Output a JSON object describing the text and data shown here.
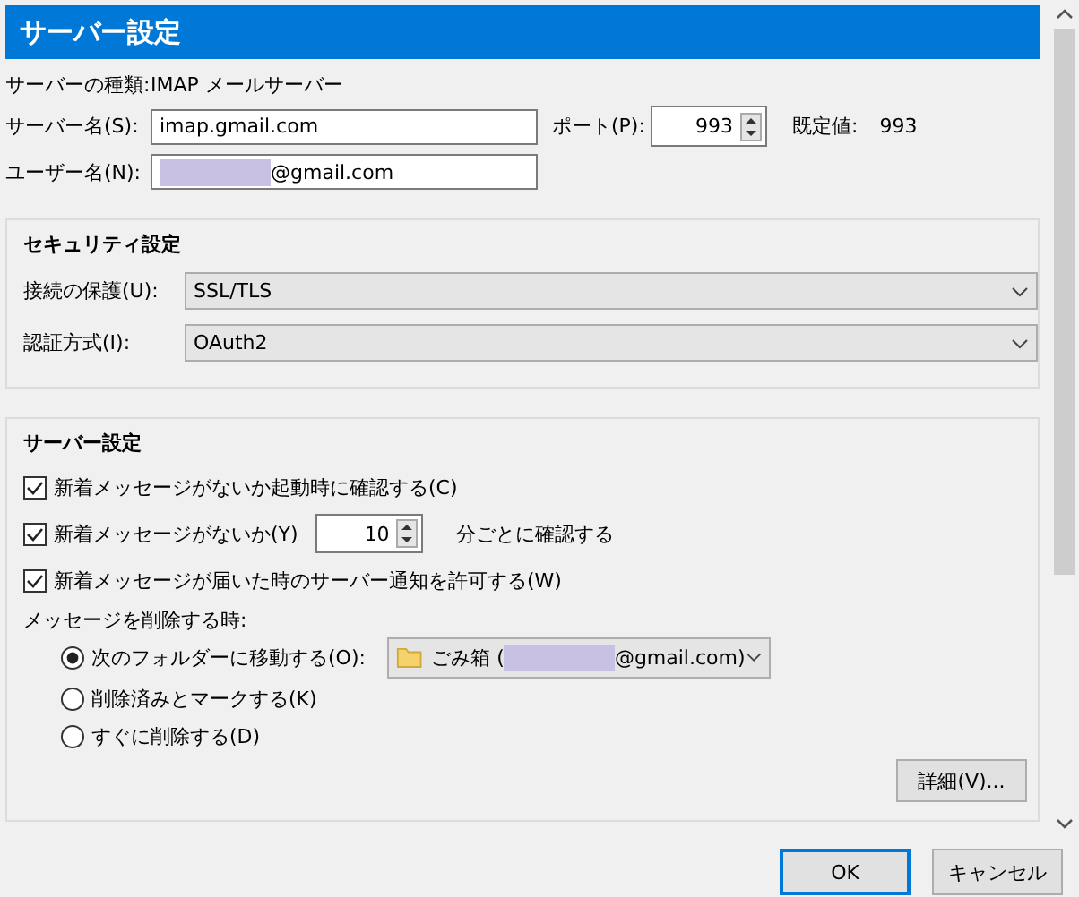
{
  "header": {
    "title": "サーバー設定"
  },
  "server": {
    "type_label": "サーバーの種類:",
    "type_value": "IMAP メールサーバー",
    "name_label": "サーバー名(S):",
    "name_value": "imap.gmail.com",
    "port_label": "ポート(P):",
    "port_value": "993",
    "default_label": "既定値:",
    "default_value": "993",
    "user_label": "ユーザー名(N):",
    "user_value": "@gmail.com",
    "user_redacted": true
  },
  "security": {
    "title": "セキュリティ設定",
    "fields": [
      {
        "label": "接続の保護(U):",
        "value": "SSL/TLS"
      },
      {
        "label": "認証方式(I):",
        "value": "OAuth2"
      }
    ]
  },
  "server_settings": {
    "title": "サーバー設定",
    "options": [
      {
        "kind": "checkbox",
        "label": "新着メッセージがないか起動時に確認する(C)",
        "checked": true
      },
      {
        "kind": "interval",
        "label": "新着メッセージがないか(Y)",
        "checked": true,
        "value": "10",
        "suffix": "分ごとに確認する"
      },
      {
        "kind": "checkbox",
        "label": "新着メッセージが届いた時のサーバー通知を許可する(W)",
        "checked": true
      }
    ],
    "delete_label": "メッセージを削除する時:",
    "delete_options": [
      {
        "label": "次のフォルダーに移動する(O):",
        "selected": true,
        "folder": {
          "name": "ごみ箱 (",
          "suffix": "@gmail.com)",
          "redacted": true
        }
      },
      {
        "label": "削除済みとマークする(K)",
        "selected": false
      },
      {
        "label": "すぐに削除する(D)",
        "selected": false
      }
    ],
    "advanced_button": "詳細(V)..."
  },
  "buttons": [
    {
      "label": "OK",
      "default": true
    },
    {
      "label": "キャンセル",
      "default": false
    }
  ]
}
